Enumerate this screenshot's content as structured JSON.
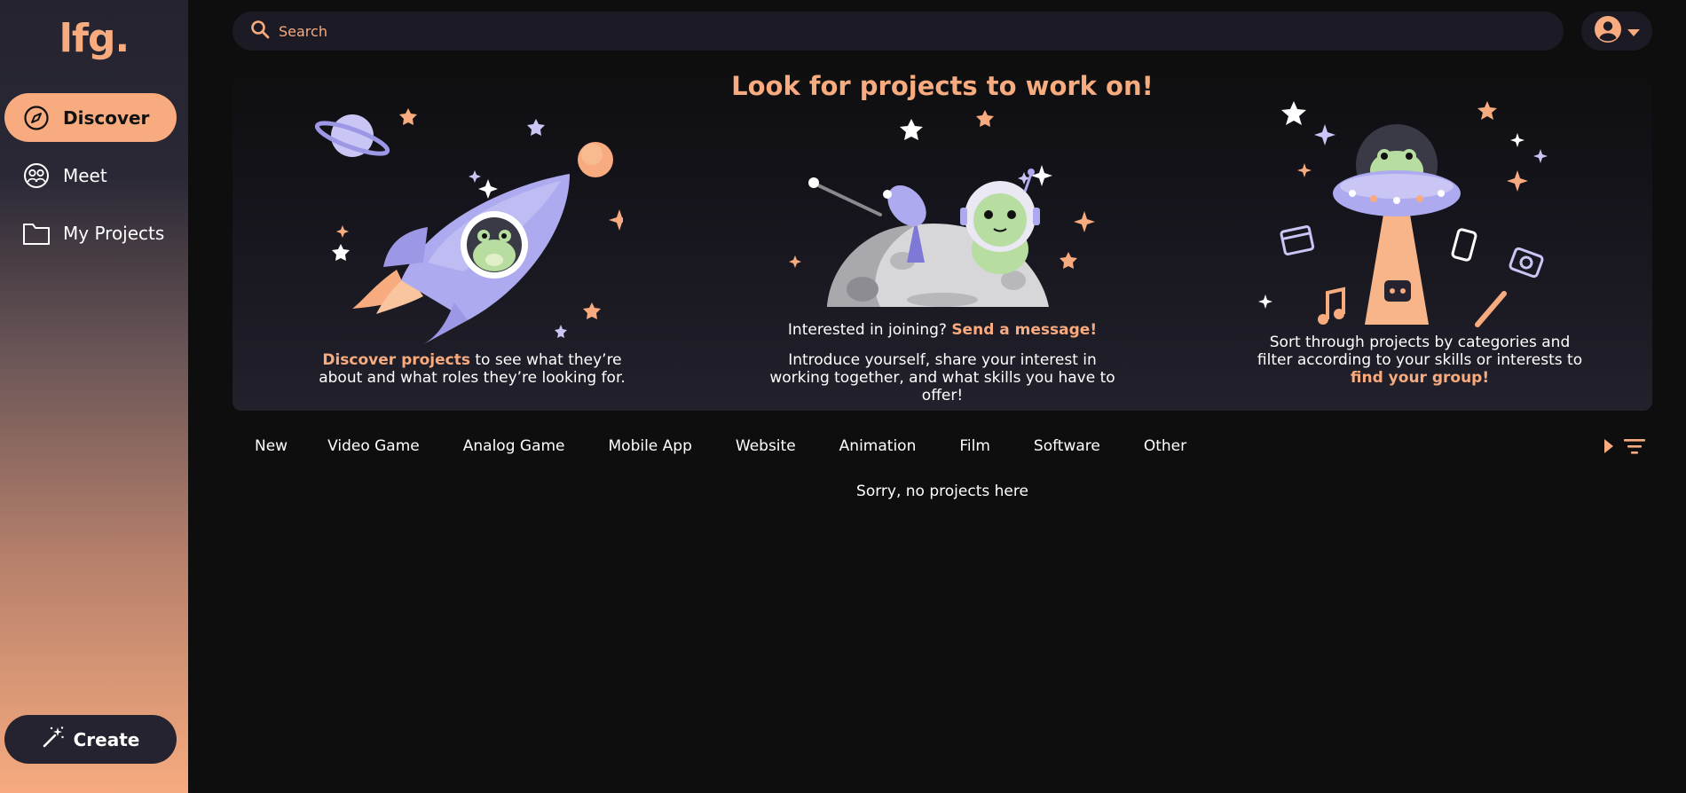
{
  "app": {
    "logo": "lfg."
  },
  "sidebar": {
    "items": [
      {
        "label": "Discover",
        "icon": "compass-icon",
        "active": true
      },
      {
        "label": "Meet",
        "icon": "people-icon",
        "active": false
      },
      {
        "label": "My Projects",
        "icon": "folder-icon",
        "active": false
      }
    ],
    "create_label": "Create"
  },
  "search": {
    "placeholder": "Search"
  },
  "hero": {
    "title": "Look for projects to work on!",
    "left": {
      "highlight": "Discover projects",
      "text": " to see what they’re about and what roles they’re looking for."
    },
    "middle": {
      "line1_prefix": "Interested in joining? ",
      "line1_highlight": "Send a message!",
      "line2": "Introduce yourself, share your interest in working together, and what skills you have to offer!"
    },
    "right": {
      "text": "Sort through projects by categories and filter according to your skills or interests to ",
      "highlight": "find your group!"
    }
  },
  "tabs": [
    "New",
    "Video Game",
    "Analog Game",
    "Mobile App",
    "Website",
    "Animation",
    "Film",
    "Software",
    "Other"
  ],
  "empty_message": "Sorry, no projects here",
  "colors": {
    "accent": "#f7ab7e",
    "panel": "#1c1b25",
    "lavender": "#aeaaf0",
    "frog": "#b7dda0"
  }
}
